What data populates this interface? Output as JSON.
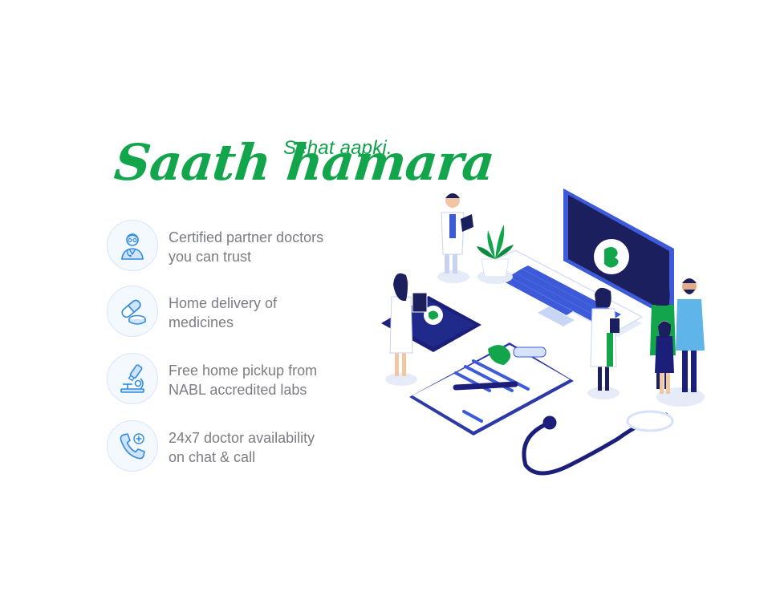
{
  "hero": {
    "tagline": "Sehat aapki.",
    "headline": "Saath hamara"
  },
  "features": [
    {
      "icon": "doctor-icon",
      "line1": "Certified partner doctors",
      "line2": "you can trust"
    },
    {
      "icon": "pills-icon",
      "line1": "Home delivery of",
      "line2": "medicines"
    },
    {
      "icon": "microscope-icon",
      "line1": "Free home pickup from",
      "line2": "NABL accredited labs"
    },
    {
      "icon": "phone-plus-icon",
      "line1": "24x7 doctor availability",
      "line2": "on chat & call"
    }
  ],
  "colors": {
    "brand_green": "#12a54b",
    "navy": "#1b1f7a",
    "blue": "#3d5bd9",
    "icon_blue": "#2f8be0",
    "text_grey": "#7a7d84"
  }
}
